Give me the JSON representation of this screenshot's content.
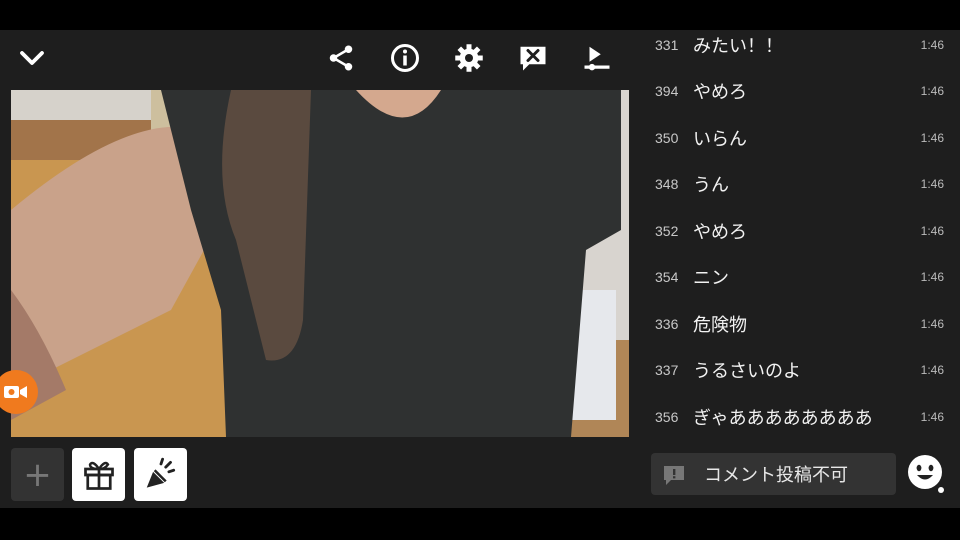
{
  "toolbar": {
    "icons": [
      "chevron-down-icon",
      "share-icon",
      "info-icon",
      "gear-icon",
      "comment-off-icon",
      "upload-icon"
    ]
  },
  "comments": [
    {
      "number": "331",
      "text": "みたい！！",
      "time": "1:46"
    },
    {
      "number": "394",
      "text": "やめろ",
      "time": "1:46"
    },
    {
      "number": "350",
      "text": "いらん",
      "time": "1:46"
    },
    {
      "number": "348",
      "text": "うん",
      "time": "1:46"
    },
    {
      "number": "352",
      "text": "やめろ",
      "time": "1:46"
    },
    {
      "number": "354",
      "text": "ニン",
      "time": "1:46"
    },
    {
      "number": "336",
      "text": "危険物",
      "time": "1:46"
    },
    {
      "number": "337",
      "text": "うるさいのよ",
      "time": "1:46"
    },
    {
      "number": "356",
      "text": "ぎゃああああああああ",
      "time": "1:46"
    }
  ],
  "comment_input": {
    "label": "コメント投稿不可"
  },
  "actions": {
    "plus": "+"
  },
  "colors": {
    "background": "#1e1e1e",
    "camera_accent": "#f07a1e",
    "text": "#ffffff"
  }
}
